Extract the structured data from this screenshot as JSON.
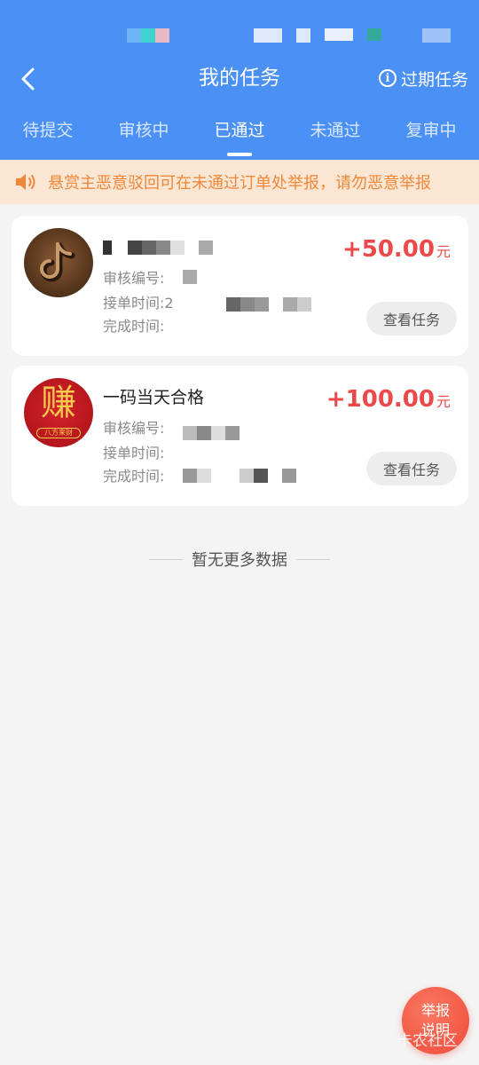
{
  "header": {
    "title": "我的任务",
    "expired_label": "过期任务",
    "colors": {
      "primary": "#4a90f5",
      "accent": "#ec4a4a",
      "notice": "#f0883a"
    }
  },
  "tabs": [
    {
      "label": "待提交",
      "active": false
    },
    {
      "label": "审核中",
      "active": false
    },
    {
      "label": "已通过",
      "active": true
    },
    {
      "label": "未通过",
      "active": false
    },
    {
      "label": "复审中",
      "active": false
    }
  ],
  "notice": {
    "icon": "speaker-icon",
    "text": "悬赏主恶意驳回可在未通过订单处举报，请勿恶意举报"
  },
  "tasks": [
    {
      "avatar_icon": "tiktok-logo",
      "title": "",
      "reward": "+50.00",
      "unit": "元",
      "review_no_label": "审核编号:",
      "accept_time_label": "接单时间:",
      "accept_time_value": "2",
      "finish_time_label": "完成时间:",
      "button": "查看任务"
    },
    {
      "avatar_icon": "zhuan-logo",
      "avatar_big": "赚",
      "avatar_small": "八方来财",
      "title": "一码当天合格",
      "reward": "+100.00",
      "unit": "元",
      "review_no_label": "审核编号:",
      "accept_time_label": "接单时间:",
      "finish_time_label": "完成时间:",
      "button": "查看任务"
    }
  ],
  "footer": {
    "end_text": "暂无更多数据",
    "report_button": [
      "举报",
      "说明"
    ],
    "watermark": "卡农社区"
  }
}
